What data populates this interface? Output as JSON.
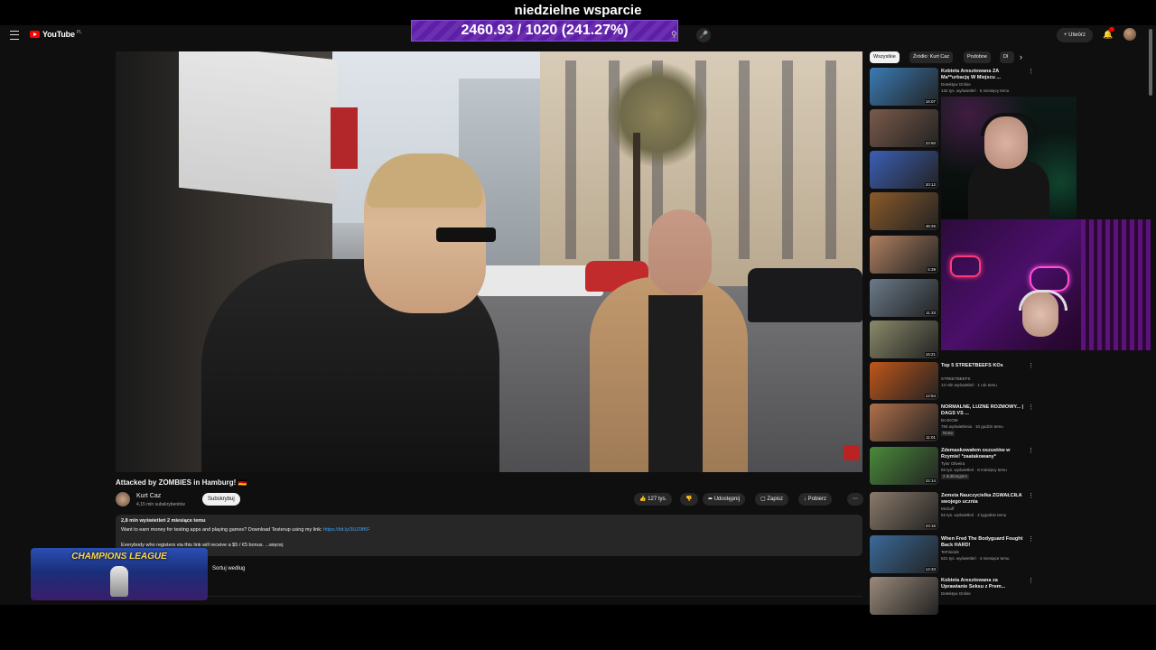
{
  "overlay": {
    "goal_title": "niedzielne wsparcie",
    "goal_amount": "2460.93 / 1020 (241.27%)",
    "goal_progress": 2.4127,
    "bar_color": "#5e1fa8"
  },
  "header": {
    "logo_text": "YouTube",
    "logo_region": "PL",
    "create_label": "Utwórz",
    "bell_badge": "9+",
    "icons": [
      "menu-icon",
      "search-icon",
      "mic-icon",
      "bell-icon"
    ]
  },
  "video": {
    "title": "Attacked by ZOMBIES in Hamburg! 🇩🇪",
    "channel": "Kurt Caz",
    "subscribers": "4,15 mln subskrybentów",
    "subscribe_label": "Subskrybuj",
    "likes": "127 tys.",
    "share_label": "Udostępnij",
    "save_label": "Zapisz",
    "download_label": "Pobierz",
    "desc_meta": "2,8 mln wyświetleń  2 miesiące temu",
    "desc_line1": "Want to earn money for testing apps and playing games? Download Testerup using my link: ",
    "desc_link": "https://bit.ly/3UZ0fKF",
    "desc_line2": "Everybody who registers via this link will receive a $5 / €5 bonus. ...więcej",
    "sort_label": "Sortuj według"
  },
  "overlay_bottom": {
    "cl_text": "CHAMPIONS LEAGUE"
  },
  "chips": [
    "Wszystkie",
    "Źródło: Kurt Caz",
    "Podobne",
    "Dl"
  ],
  "recommendations": [
    {
      "title": "Kobieta Aresztowana ZA Ma**urbację W Miejscu ...",
      "channel": "Detektyw Online",
      "meta": "132 tys. wyświetleń · 5 miesięcy temu",
      "duration": "16:07",
      "color": "#3a7bb5"
    },
    {
      "title": "",
      "channel": "",
      "meta": "",
      "duration": "23:50",
      "color": "#7a5a4a"
    },
    {
      "title": "",
      "channel": "",
      "meta": "",
      "duration": "20:12",
      "color": "#3b5fb5"
    },
    {
      "title": "",
      "channel": "",
      "meta": "",
      "duration": "48:26",
      "color": "#8a5a2a"
    },
    {
      "title": "",
      "channel": "",
      "meta": "",
      "duration": "5:39",
      "color": "#b08060"
    },
    {
      "title": "",
      "channel": "",
      "meta": "",
      "duration": "11:33",
      "color": "#6a7a8a"
    },
    {
      "title": "",
      "channel": "",
      "meta": "",
      "duration": "16:21",
      "color": "#8a8a6a"
    },
    {
      "title": "Top 5 STREETBEEFS KOs",
      "channel": "STREETBEEFS",
      "meta": "12 mln wyświetleń · 1 rok temu",
      "duration": "12:54",
      "color": "#c0561a"
    },
    {
      "title": "NORMALNE, LUZNE ROZMOWY... | DAGS VS ...",
      "channel": "BAJKOM",
      "meta": "784 wyświetlenia · 10 godzin temu",
      "duration": "11:01",
      "color": "#b0704a",
      "badge": "Nowy"
    },
    {
      "title": "Zdemaskowałem oszustów w Rzymie! *zaatakowany*",
      "channel": "Tylor Oliveira",
      "meta": "92 tys. wyświetleń · 8 miesięcy temu",
      "duration": "22:14",
      "color": "#4a8a3a",
      "badge": "2 dubbingiem"
    },
    {
      "title": "Zemsta Nauczycielka ZGWAŁCIŁA swojego ucznia",
      "channel": "McGuff",
      "meta": "52 tys. wyświetleń · 2 tygodnie temu",
      "duration": "23:16",
      "color": "#8a7a6a"
    },
    {
      "title": "When Fred The Bodyguard Fought Back HARD!",
      "channel": "TeFriends",
      "meta": "521 tys. wyświetleń · 4 miesiące temu",
      "duration": "14:33",
      "color": "#3a6a9a"
    },
    {
      "title": "Kobieta Aresztowana za Uprawianie Seksu z Prem...",
      "channel": "Detektyw Online",
      "meta": "",
      "duration": "",
      "color": "#9a8a7a"
    }
  ]
}
